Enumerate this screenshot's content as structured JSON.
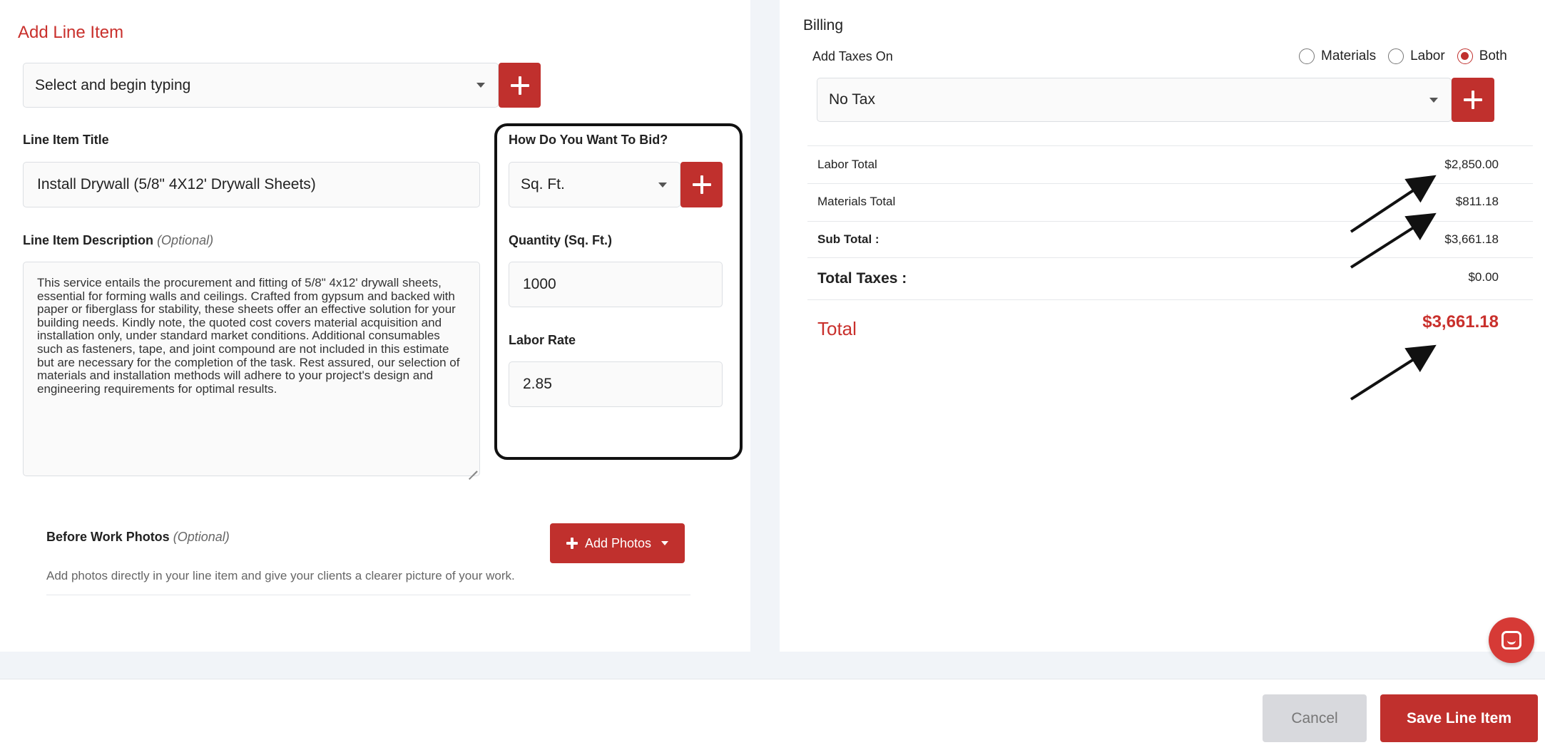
{
  "line_item": {
    "heading": "Add Line Item",
    "select_placeholder": "Select and begin typing",
    "title_label": "Line Item Title",
    "title_value": "Install Drywall (5/8\" 4X12' Drywall Sheets)",
    "description_label": "Line Item Description",
    "optional_text": "(Optional)",
    "description_value": "This service entails the procurement and fitting of 5/8\" 4x12' drywall sheets, essential for forming walls and ceilings. Crafted from gypsum and backed with paper or fiberglass for stability, these sheets offer an effective solution for your building needs. Kindly note, the quoted cost covers material acquisition and installation only, under standard market conditions. Additional consumables such as fasteners, tape, and joint compound are not included in this estimate but are necessary for the completion of the task. Rest assured, our selection of materials and installation methods will adhere to your project's design and engineering requirements for optimal results."
  },
  "bid": {
    "label": "How Do You Want To Bid?",
    "unit_value": "Sq. Ft.",
    "quantity_label": "Quantity (Sq. Ft.)",
    "quantity_value": "1000",
    "labor_rate_label": "Labor Rate",
    "labor_rate_value": "2.85"
  },
  "photos": {
    "label": "Before Work Photos",
    "optional_text": "(Optional)",
    "help_text": "Add photos directly in your line item and give your clients a clearer picture of your work.",
    "button_label": "Add Photos"
  },
  "billing": {
    "heading": "Billing",
    "taxes_label": "Add Taxes On",
    "options": [
      "Materials",
      "Labor",
      "Both"
    ],
    "selected_option": "Both",
    "tax_value": "No Tax",
    "rows": [
      {
        "label": "Labor Total",
        "value": "$2,850.00"
      },
      {
        "label": "Materials Total",
        "value": "$811.18"
      },
      {
        "label": "Sub Total :",
        "value": "$3,661.18"
      },
      {
        "label": "Total Taxes :",
        "value": "$0.00"
      }
    ],
    "total_label": "Total",
    "total_value": "$3,661.18"
  },
  "footer": {
    "cancel_label": "Cancel",
    "save_label": "Save Line Item"
  },
  "colors": {
    "accent": "#c0302d",
    "heading_red": "#c9302c"
  }
}
